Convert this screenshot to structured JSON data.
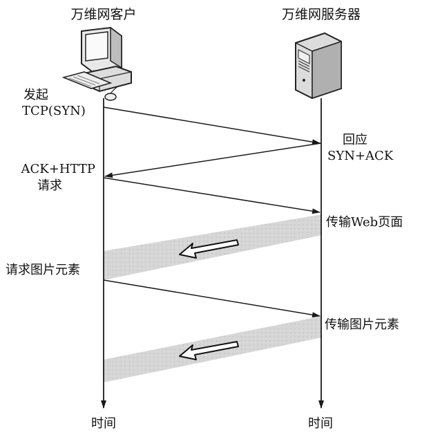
{
  "client": {
    "title": "万维网客户",
    "time_label": "时间",
    "labels": {
      "syn_line1": "发起",
      "syn_line2": "TCP(SYN)",
      "ack_line1": "ACK+HTTP",
      "ack_line2": "请求",
      "img_req": "请求图片元素"
    }
  },
  "server": {
    "title": "万维网服务器",
    "time_label": "时间",
    "labels": {
      "reply_line1": "回应",
      "reply_line2": "SYN+ACK",
      "send_web": "传输Web页面",
      "send_img": "传输图片元素"
    }
  },
  "icons": {
    "client": "desktop-computer-icon",
    "server": "server-tower-icon"
  },
  "colors": {
    "line": "#1a1a1a",
    "band": "#d9d9d9",
    "arrow_fill": "#ffffff"
  }
}
